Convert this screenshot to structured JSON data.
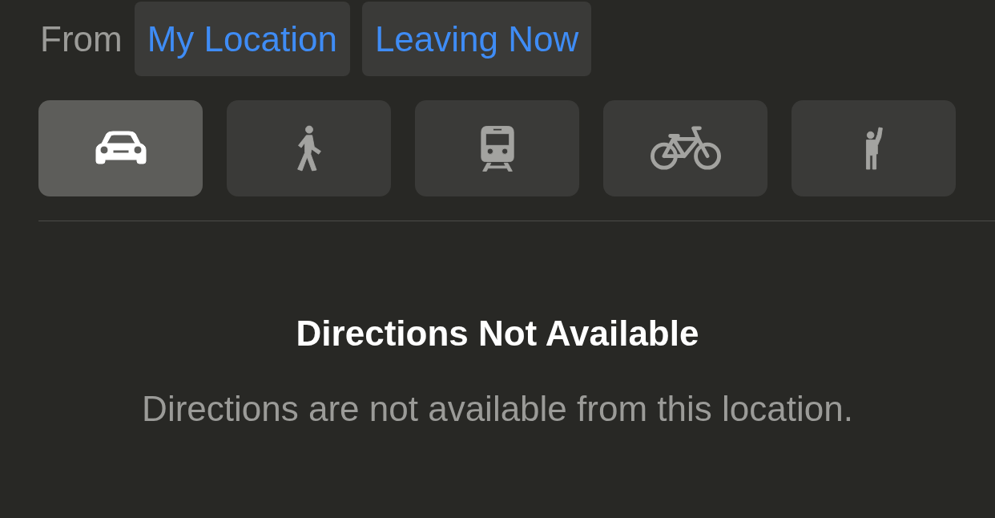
{
  "from_label": "From",
  "origin_button": "My Location",
  "time_button": "Leaving Now",
  "modes": [
    {
      "kind": "car",
      "selected": true
    },
    {
      "kind": "walk",
      "selected": false
    },
    {
      "kind": "transit",
      "selected": false
    },
    {
      "kind": "bike",
      "selected": false
    },
    {
      "kind": "rideshare",
      "selected": false
    }
  ],
  "message": {
    "title": "Directions Not Available",
    "body": "Directions are not available from this location."
  }
}
